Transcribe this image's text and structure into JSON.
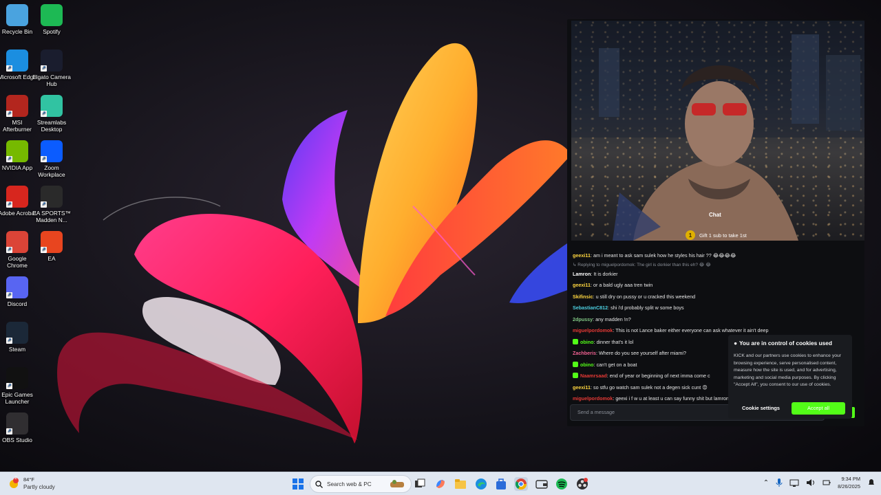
{
  "desktop_icons": [
    {
      "name": "recycle-bin",
      "label": "Recycle Bin",
      "color": "#4aa3df"
    },
    {
      "name": "spotify",
      "label": "Spotify",
      "color": "#1db954"
    },
    {
      "name": "microsoft-edge",
      "label": "Microsoft Edge",
      "color": "#1b8ee0"
    },
    {
      "name": "elgato-camera-hub",
      "label": "Elgato Camera Hub",
      "color": "#1a1d2e"
    },
    {
      "name": "msi-afterburner",
      "label": "MSI Afterburner",
      "color": "#b3261e"
    },
    {
      "name": "streamlabs-desktop",
      "label": "Streamlabs Desktop",
      "color": "#31c3a2"
    },
    {
      "name": "nvidia-app",
      "label": "NVIDIA App",
      "color": "#76b900"
    },
    {
      "name": "zoom-workplace",
      "label": "Zoom Workplace",
      "color": "#0b5cff"
    },
    {
      "name": "adobe-acrobat",
      "label": "Adobe Acrobat",
      "color": "#d7261e"
    },
    {
      "name": "ea-sports-madden",
      "label": "EA SPORTS™ Madden N...",
      "color": "#2a2a2a"
    },
    {
      "name": "google-chrome",
      "label": "Google Chrome",
      "color": "#db4437"
    },
    {
      "name": "ea",
      "label": "EA",
      "color": "#e8451f"
    },
    {
      "name": "discord",
      "label": "Discord",
      "color": "#5865f2"
    },
    {
      "name": "steam",
      "label": "Steam",
      "color": "#1b2838"
    },
    {
      "name": "epic-games-launcher",
      "label": "Epic Games Launcher",
      "color": "#111111"
    },
    {
      "name": "obs-studio",
      "label": "OBS Studio",
      "color": "#302e31"
    }
  ],
  "stream": {
    "chat_label": "Chat",
    "sub_banner": "Gift 1 sub to take 1st",
    "sub_banner_count": "1",
    "messages": [
      {
        "user": "geexi11",
        "color": "#ffd740",
        "text": "am i meant to ask sam sulek how he styles his hair ?? 😂😂😂😂",
        "badge": false
      },
      {
        "user": "Lamron",
        "color": "#ffffff",
        "text": "It is dorkier",
        "badge": false,
        "reply": "↳ Replying to miguelpordomok: The girl is dorkier than this eh? 😂 😂"
      },
      {
        "user": "geexi11",
        "color": "#ffd740",
        "text": "or a bald ugly aaa tren twin",
        "badge": false
      },
      {
        "user": "Skifinsic",
        "color": "#ffd740",
        "text": "u still dry on pussy or u cracked this weekend",
        "badge": false
      },
      {
        "user": "SebastianC812",
        "color": "#4dd0e1",
        "text": "shi i'd probably split w some boys",
        "badge": false
      },
      {
        "user": "2dpussy",
        "color": "#81c784",
        "text": "any madden !n?",
        "badge": false
      },
      {
        "user": "miguelpordomok",
        "color": "#e53935",
        "text": "This is not Lance baker either everyone can ask whatever it ain't deep",
        "badge": false
      },
      {
        "user": "obino",
        "color": "#53fc18",
        "text": "dinner that's it lol",
        "badge": true
      },
      {
        "user": "Zachberis",
        "color": "#f06292",
        "text": "Where do you see yourself after miami?",
        "badge": false
      },
      {
        "user": "obino",
        "color": "#53fc18",
        "text": "can't get on a boat",
        "badge": true
      },
      {
        "user": "Naamrsaad",
        "color": "#e53935",
        "text": "end of year or beginning of next imma come c",
        "badge": true
      },
      {
        "user": "geexi11",
        "color": "#ffd740",
        "text": "so stfu go watch sam sulek not a degen sick cunt 😡",
        "badge": false
      },
      {
        "user": "miguelpordomok",
        "color": "#e53935",
        "text": "geexi i f w u at least u can say funny shit but lamron",
        "badge": false
      }
    ],
    "input_placeholder": "Send a message"
  },
  "cookie": {
    "title": "You are in control of cookies used",
    "text": "KICK and our partners use cookies to enhance your browsing experience, serve personalised content, measure how the site is used, and for advertising, marketing and social media purposes. By clicking \"Accept All\", you consent to our use of cookies.",
    "settings_label": "Cookie settings",
    "accept_label": "Accept all",
    "accent": "#53fc18"
  },
  "taskbar": {
    "weather_badge": "2",
    "weather_temp": "84°F",
    "weather_condition": "Partly cloudy",
    "search_label": "Search web & PC",
    "time": "9:34 PM",
    "date": "8/26/2025",
    "pinned_apps": [
      "start-icon",
      "search-icon",
      "task-view-icon",
      "copilot-icon",
      "file-explorer-icon",
      "edge-icon",
      "store-icon",
      "chrome-icon",
      "wallet-icon",
      "spotify-icon",
      "obs-icon"
    ]
  }
}
